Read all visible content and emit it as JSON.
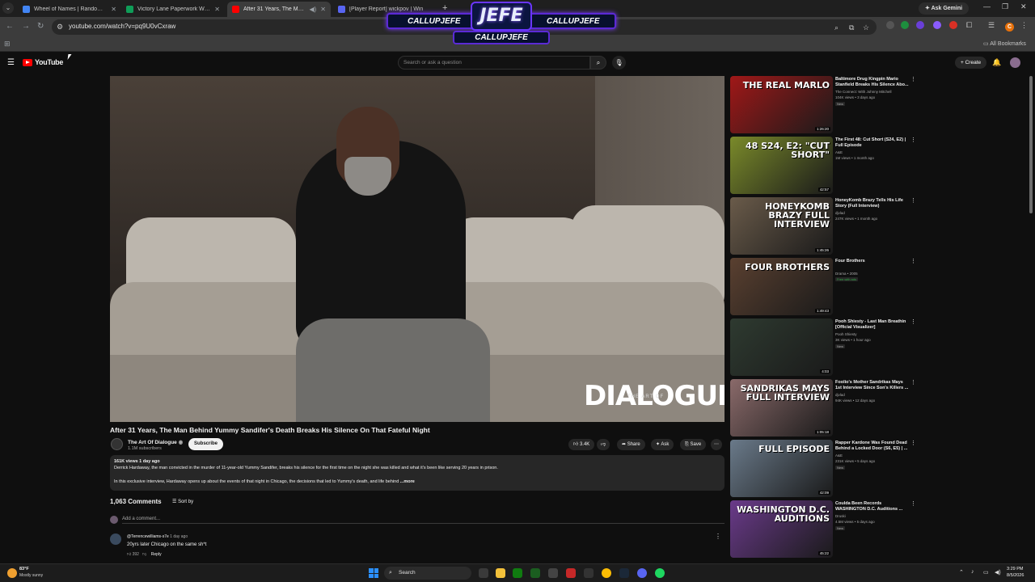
{
  "browser": {
    "tabs": [
      {
        "label": "Wheel of Names | Random nam",
        "favicon_color": "#4285f4"
      },
      {
        "label": "Victory Lane Paperwork WCRP",
        "favicon_color": "#0f9d58"
      },
      {
        "label": "After 31 Years, The Man Be",
        "favicon_color": "#ff0000"
      },
      {
        "label": "[Player Report] wickpov | Win",
        "favicon_color": "#5865f2"
      }
    ],
    "ask_gemini": "Ask Gemini",
    "url": "youtube.com/watch?v=pq9U0vCxraw",
    "all_bookmarks": "All Bookmarks",
    "profile_initial": "C"
  },
  "overlay": {
    "logo": "JEFE",
    "handle_left": "CALLUPJEFE",
    "handle_right": "CALLUPJEFE",
    "handle_bottom": "CALLUPJEFE"
  },
  "youtube": {
    "logo": "YouTube",
    "search_placeholder": "Search or ask a question",
    "create": "Create"
  },
  "video": {
    "watermark": "DIALOGUE",
    "watermark_sub": "THE ART OF",
    "title": "After 31 Years, The Man Behind Yummy Sandifer's Death Breaks His Silence On That Fateful Night",
    "channel": "The Art Of Dialogue",
    "subscribers": "1.1M subscribers",
    "subscribe": "Subscribe",
    "likes": "3.4K",
    "share": "Share",
    "ask": "Ask",
    "save": "Save",
    "views_date": "161K views  1 day ago",
    "description_line1": "Derrick Hardaway, the man convicted in the murder of 11-year-old Yummy Sandifer, breaks his silence for the first time on the night she was killed and what it's been like serving 20 years in prison.",
    "description_line2": "In this exclusive interview, Hardaway opens up about the events of that night in Chicago, the decisions that led to Yummy's death, and life behind ",
    "more": "...more"
  },
  "comments": {
    "count": "1,063 Comments",
    "sort_by": "Sort by",
    "add_placeholder": "Add a comment...",
    "first": {
      "author": "@Terrencewilliams-s7e",
      "time": "1 day ago",
      "text": "20yrs later Chicago on the same sh*t",
      "likes": "392",
      "reply": "Reply"
    }
  },
  "recommendations": [
    {
      "title": "Baltimore Drug Kingpin Mario Stanfield Breaks His Silence Abo...",
      "channel": "The Connect: With Johnny Mitchell",
      "views": "104K views • 3 days ago",
      "badge": "New",
      "duration": "1:26:20",
      "thumb_text": "THE REAL MARLO",
      "thumb_color": "#a01818"
    },
    {
      "title": "The First 48: Cut Short (S24, E2) | Full Episode",
      "channel": "A&E",
      "views": "1M views • 1 month ago",
      "badge": "",
      "duration": "42:57",
      "thumb_text": "48 S24, E2: \"CUT SHORT\"",
      "thumb_color": "#7a8a2a"
    },
    {
      "title": "HoneyKomb Brazy Tells His Life Story (Full Interview)",
      "channel": "djvlad",
      "views": "247K views • 1 month ago",
      "badge": "",
      "duration": "1:45:26",
      "thumb_text": "HONEYKOMB BRAZY FULL INTERVIEW",
      "thumb_color": "#6a5b4a"
    },
    {
      "title": "Four Brothers",
      "channel": "Drama • 2005",
      "views": "",
      "badge": "Free with ads",
      "duration": "1:49:43",
      "thumb_text": "FOUR BROTHERS",
      "thumb_color": "#5a4030"
    },
    {
      "title": "Pooh Shiesty - Last Man Breathin [Official Visualizer]",
      "channel": "Pooh Shiesty",
      "views": "3K views • 1 hour ago",
      "badge": "New",
      "duration": "4:03",
      "thumb_text": "",
      "thumb_color": "#2e3a30"
    },
    {
      "title": "Foolio's Mother Sandrikas Mays 1st Interview Since Son's Killers ...",
      "channel": "djvlad",
      "views": "94K views • 12 days ago",
      "badge": "",
      "duration": "1:05:18",
      "thumb_text": "SANDRIKAS MAYS FULL INTERVIEW",
      "thumb_color": "#8a6a6a"
    },
    {
      "title": "Rapper Kardone Was Found Dead Behind a Locked Door (S6, E5) | ...",
      "channel": "A&E",
      "views": "231K views • 5 days ago",
      "badge": "New",
      "duration": "42:09",
      "thumb_text": "FULL EPISODE",
      "thumb_color": "#6a7a8a"
    },
    {
      "title": "Coulda Been Records WASHINGTON D.C. Auditions ...",
      "channel": "Druski",
      "views": "4.5M views • 5 days ago",
      "badge": "New",
      "duration": "45:22",
      "thumb_text": "WASHINGTON D.C. AUDITIONS",
      "thumb_color": "#6a3a8a"
    }
  ],
  "taskbar": {
    "temperature": "83°F",
    "weather": "Mostly sunny",
    "search": "Search",
    "time": "3:29 PM",
    "date": "8/5/2026"
  }
}
